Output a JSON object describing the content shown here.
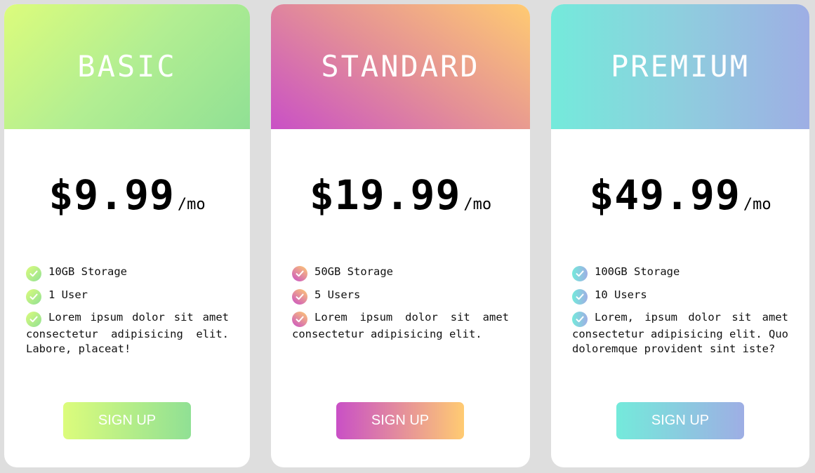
{
  "plans": [
    {
      "name": "BASIC",
      "price": "$9.99",
      "period": "/mo",
      "features": [
        "10GB Storage",
        "1 User",
        "Lorem ipsum dolor sit amet consectetur adipisicing elit. Labore, placeat!"
      ],
      "button": "SIGN UP",
      "colors": [
        "#dcfc7c",
        "#90e094"
      ]
    },
    {
      "name": "STANDARD",
      "price": "$19.99",
      "period": "/mo",
      "features": [
        "50GB Storage",
        "5 Users",
        "Lorem ipsum dolor sit amet consectetur adipisicing elit."
      ],
      "button": "SIGN UP",
      "colors": [
        "#c950c6",
        "#ffcb72"
      ]
    },
    {
      "name": "PREMIUM",
      "price": "$49.99",
      "period": "/mo",
      "features": [
        "100GB Storage",
        "10 Users",
        "Lorem, ipsum dolor sit amet consectetur adipisicing elit. Quo doloremque provident sint iste?"
      ],
      "button": "SIGN UP",
      "colors": [
        "#74eadb",
        "#9eaee4"
      ]
    }
  ],
  "icons": {
    "feature_check": "check-circle-icon"
  }
}
